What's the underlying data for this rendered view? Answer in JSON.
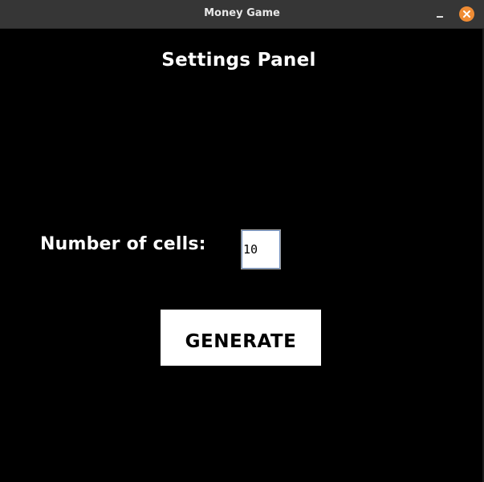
{
  "window": {
    "title": "Money Game",
    "controls": {
      "minimize_icon": "minimize-icon",
      "close_icon": "close-icon",
      "close_color": "#f08c34"
    }
  },
  "panel": {
    "title": "Settings Panel",
    "background": "#000000",
    "text_color": "#ffffff"
  },
  "form": {
    "cells_label": "Number of cells:",
    "cells_value": "10"
  },
  "actions": {
    "generate_label": "GENERATE"
  }
}
